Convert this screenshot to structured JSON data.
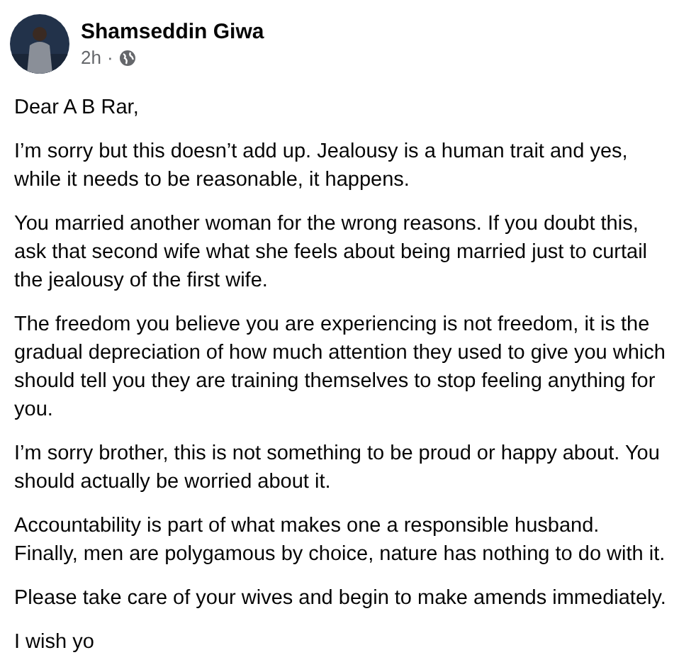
{
  "post": {
    "author": "Shamseddin Giwa",
    "time": "2h",
    "separator": "·",
    "public": true,
    "paragraphs": [
      "Dear A B Rar,",
      "I’m sorry but this doesn’t add up. Jealousy is a human trait and yes, while it needs to be reasonable, it happens.",
      "You married another woman for the wrong reasons. If you doubt this, ask that second wife what she feels about being married just to curtail the jealousy of the first wife.",
      "The freedom you believe you are experiencing is not freedom, it is the gradual depreciation of how much attention they used to give you which should tell you they are training themselves to stop feeling anything for you.",
      "I’m sorry brother, this is not something to be proud or happy about. You should actually be worried about it.",
      "Accountability is part of what makes one a responsible husband. Finally, men are polygamous by choice, nature has nothing to do with it.",
      "Please take care of your wives and begin to make amends immediately.",
      "I wish yo"
    ]
  }
}
